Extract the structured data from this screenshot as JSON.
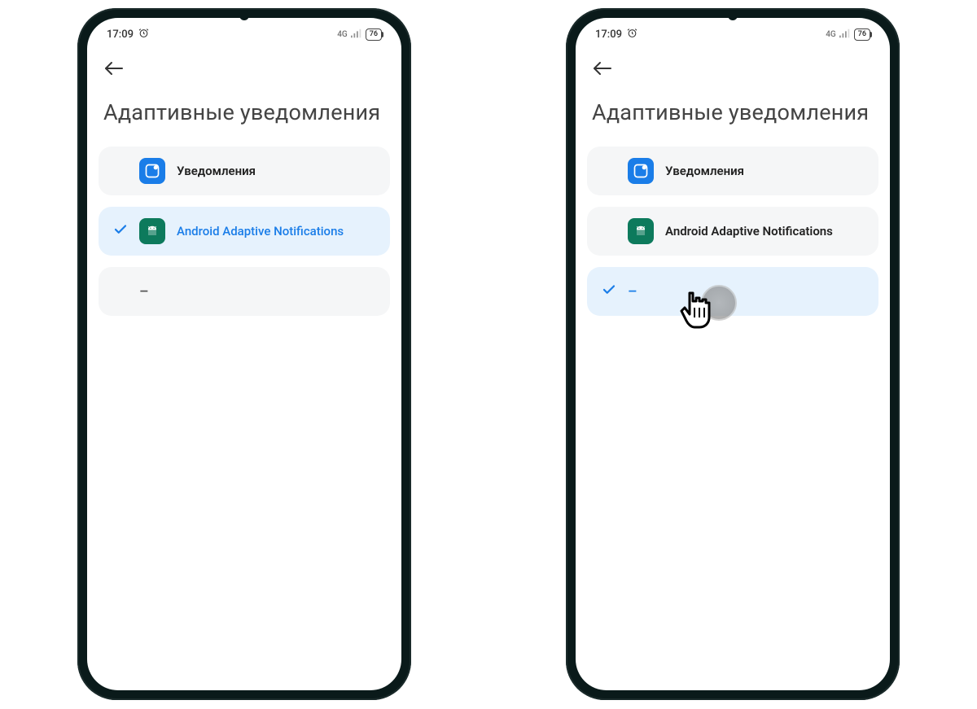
{
  "status": {
    "time": "17:09",
    "battery": "76",
    "network_label": "4G"
  },
  "page": {
    "title": "Адаптивные уведомления"
  },
  "phones": {
    "left": {
      "options": {
        "notifications": {
          "label": "Уведомления",
          "selected": false
        },
        "android_adaptive": {
          "label": "Android Adaptive Notifications",
          "selected": true
        },
        "none": {
          "label": "–",
          "selected": false
        }
      }
    },
    "right": {
      "options": {
        "notifications": {
          "label": "Уведомления",
          "selected": false
        },
        "android_adaptive": {
          "label": "Android Adaptive Notifications",
          "selected": false
        },
        "none": {
          "label": "–",
          "selected": true
        }
      }
    }
  }
}
